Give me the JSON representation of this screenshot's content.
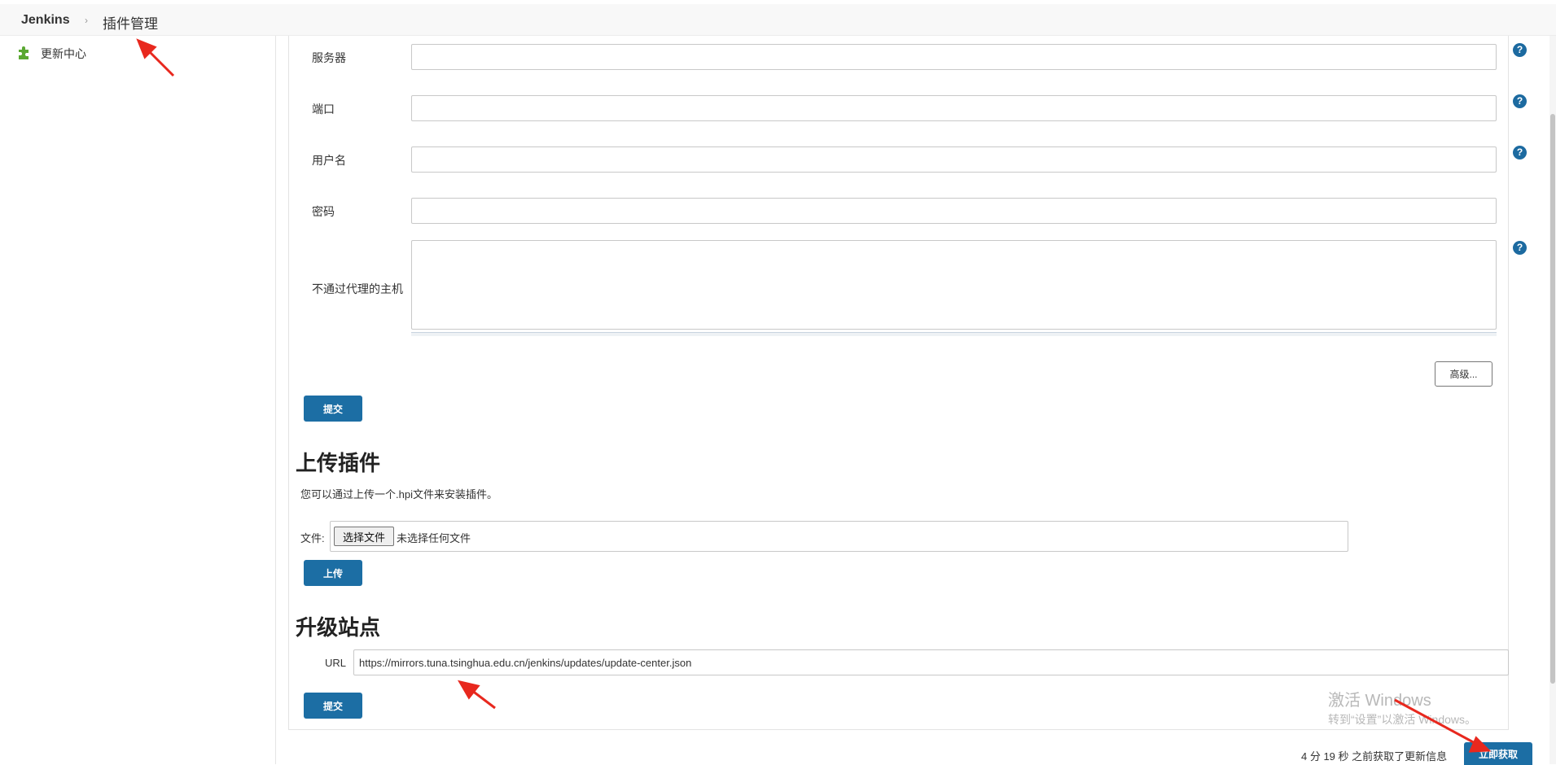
{
  "breadcrumb": {
    "root": "Jenkins",
    "separator": "›",
    "page": "插件管理"
  },
  "sidebar": {
    "items": [
      {
        "label": "更新中心",
        "icon": "puzzle-icon"
      }
    ]
  },
  "proxy": {
    "server_label": "服务器",
    "port_label": "端口",
    "username_label": "用户名",
    "password_label": "密码",
    "no_proxy_label": "不通过代理的主机",
    "server_value": "",
    "port_value": "",
    "username_value": "",
    "password_value": "",
    "no_proxy_value": "",
    "help_glyph": "?",
    "advanced_label": "高级...",
    "submit_label": "提交"
  },
  "upload": {
    "title": "上传插件",
    "description": "您可以通过上传一个.hpi文件来安装插件。",
    "file_label": "文件:",
    "choose_file_label": "选择文件",
    "no_file_text": "未选择任何文件",
    "upload_label": "上传"
  },
  "update_site": {
    "title": "升级站点",
    "url_label": "URL",
    "url_value": "https://mirrors.tuna.tsinghua.edu.cn/jenkins/updates/update-center.json",
    "submit_label": "提交"
  },
  "status": {
    "last_fetched": "4 分 19 秒 之前获取了更新信息",
    "fetch_now_label": "立即获取"
  },
  "watermark": {
    "line1": "激活 Windows",
    "line2": "转到“设置”以激活 Windows。"
  },
  "colors": {
    "accent": "#1c6ea4",
    "annotation": "#e8281e",
    "help": "#1c6aa0"
  }
}
